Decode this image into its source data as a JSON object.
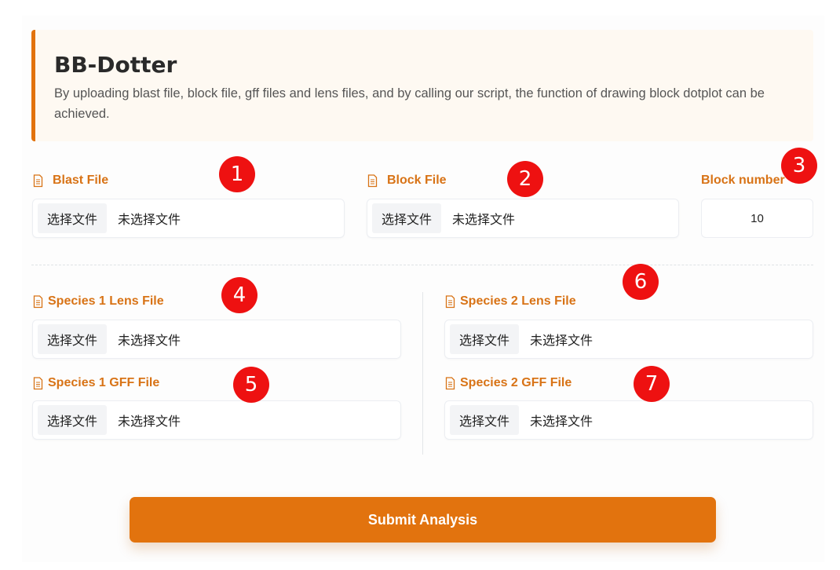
{
  "header": {
    "title": "BB-Dotter",
    "description": "By uploading blast file, block file, gff files and lens files, and by calling our script, the function of drawing block dotplot can be achieved."
  },
  "fields": {
    "blast": {
      "label": "Blast File",
      "button": "选择文件",
      "status": "未选择文件"
    },
    "block": {
      "label": "Block File",
      "button": "选择文件",
      "status": "未选择文件"
    },
    "block_number": {
      "label": "Block number",
      "value": "10"
    },
    "sp1_lens": {
      "label": "Species 1 Lens File",
      "button": "选择文件",
      "status": "未选择文件"
    },
    "sp1_gff": {
      "label": "Species 1 GFF File",
      "button": "选择文件",
      "status": "未选择文件"
    },
    "sp2_lens": {
      "label": "Species 2 Lens File",
      "button": "选择文件",
      "status": "未选择文件"
    },
    "sp2_gff": {
      "label": "Species 2 GFF File",
      "button": "选择文件",
      "status": "未选择文件"
    }
  },
  "badges": [
    "1",
    "2",
    "3",
    "4",
    "5",
    "6",
    "7"
  ],
  "submit_label": "Submit Analysis",
  "icons": {
    "file": "document-icon"
  },
  "colors": {
    "accent": "#e2730e",
    "badge": "#ee1111"
  }
}
